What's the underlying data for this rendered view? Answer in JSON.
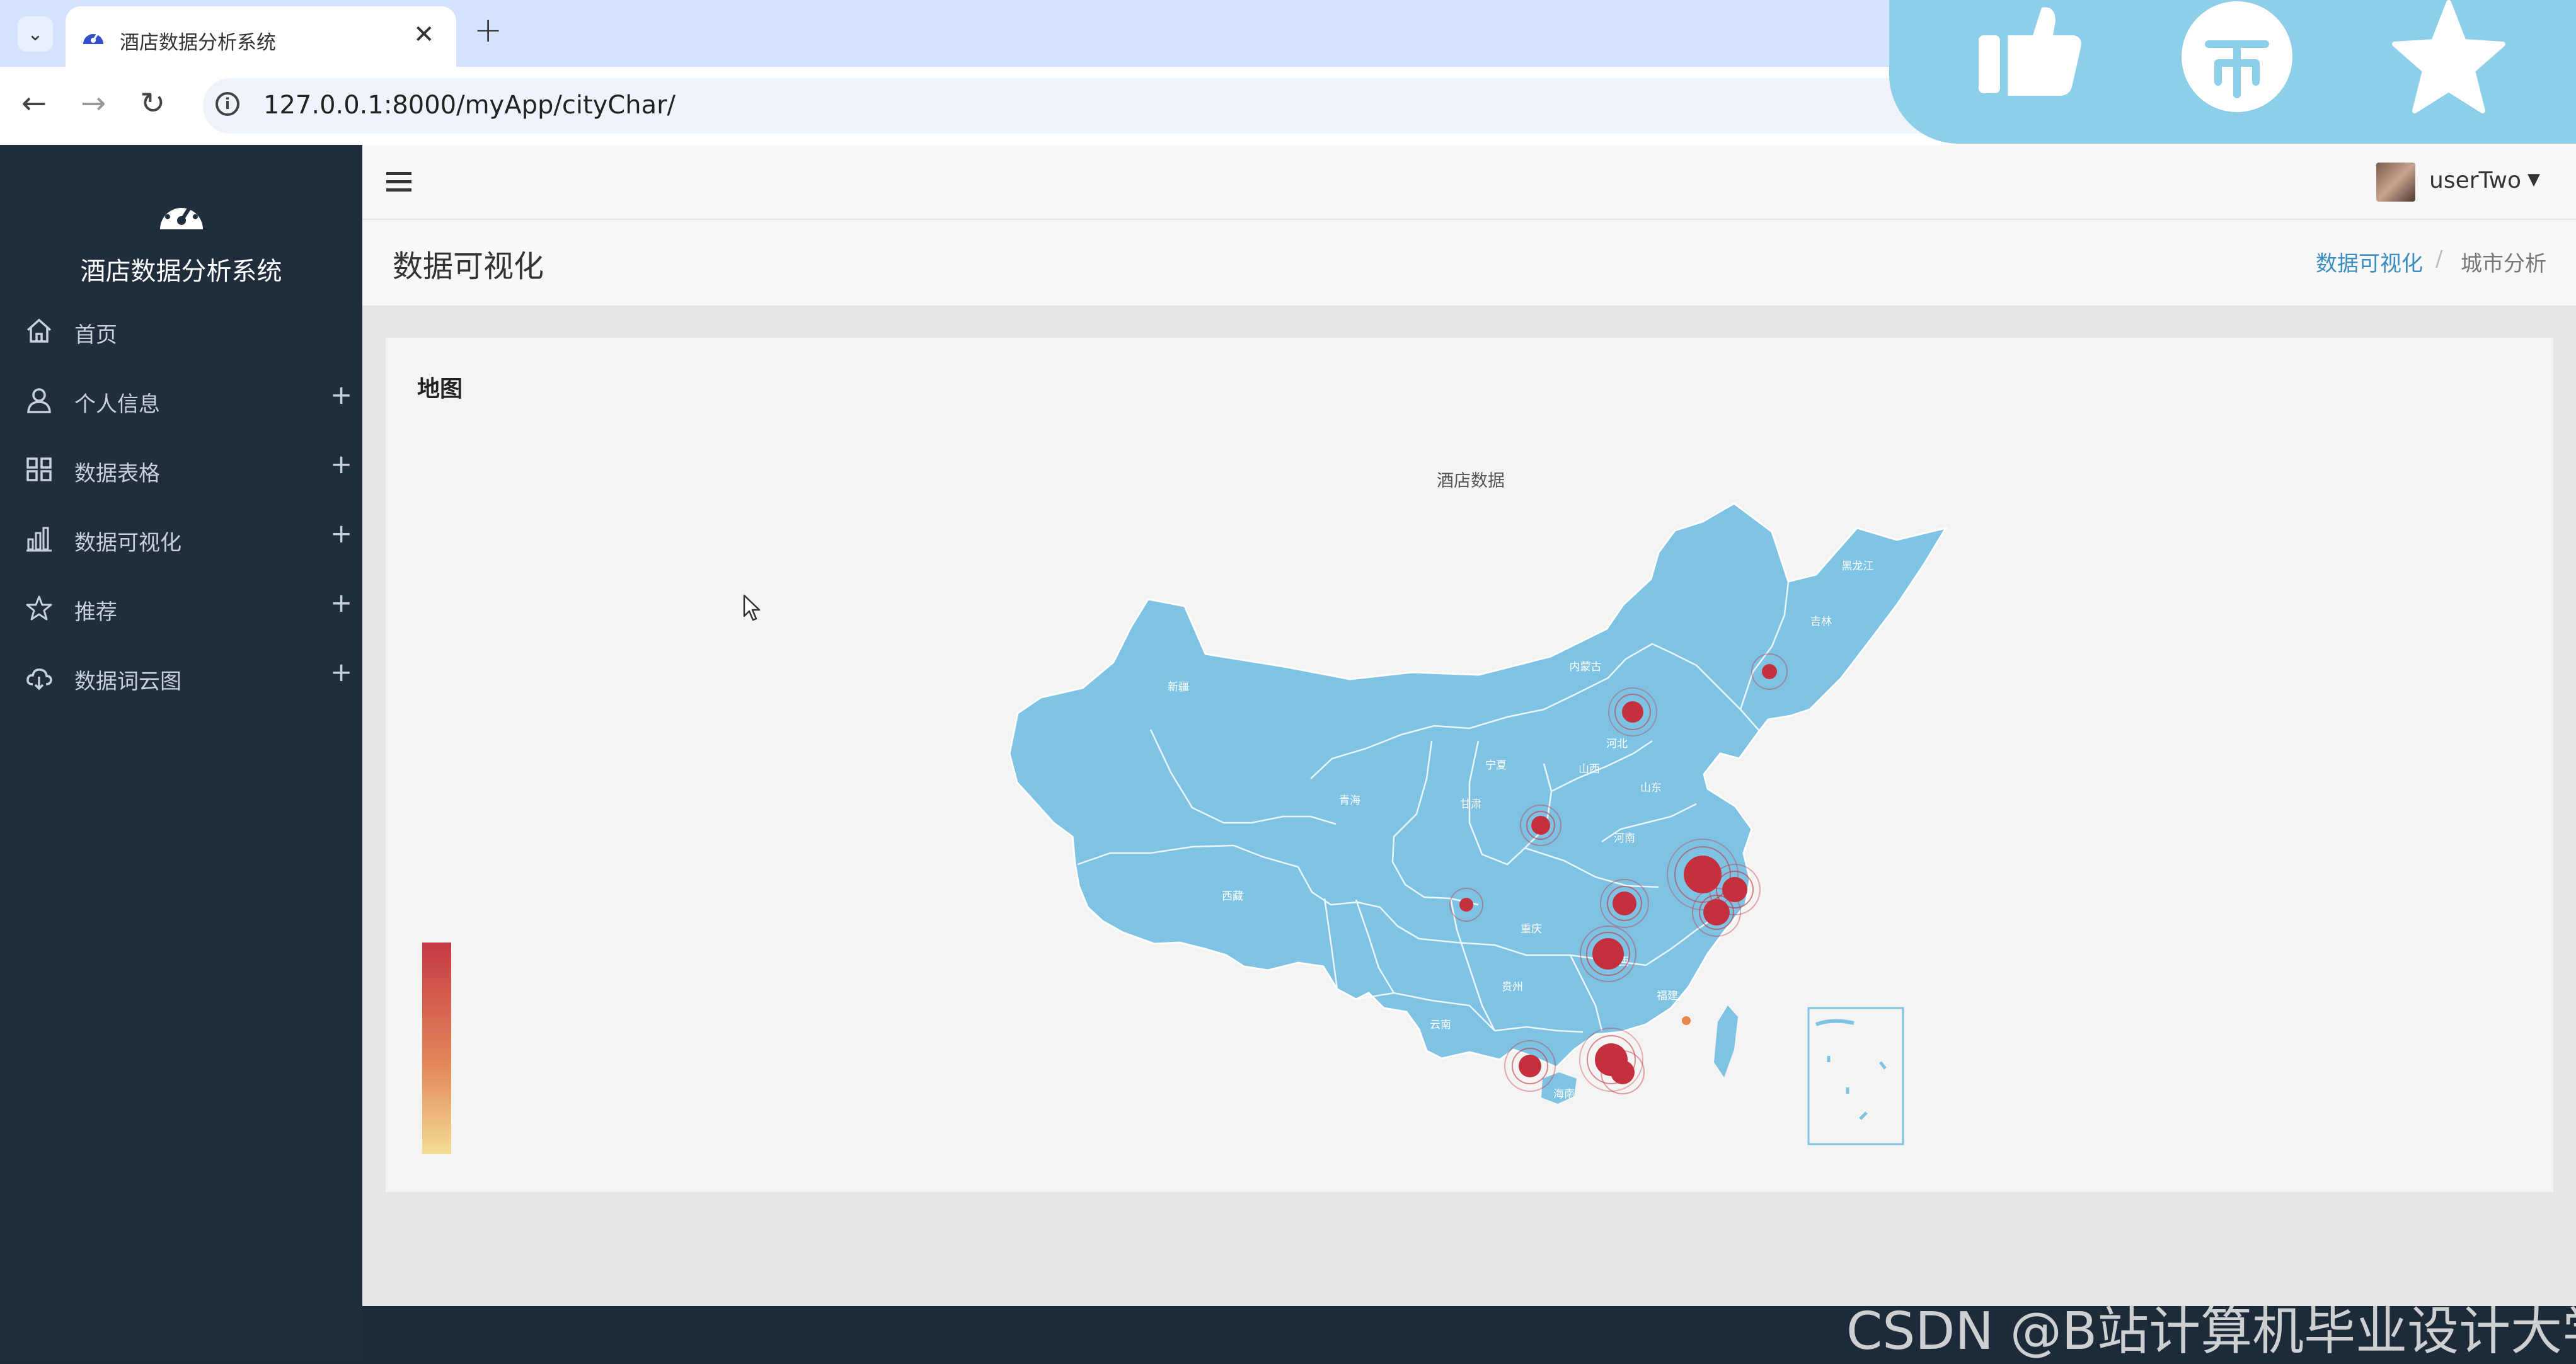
{
  "browser": {
    "tab_title": "酒店数据分析系统",
    "tab_close": "✕",
    "new_tab": "+",
    "url": "127.0.0.1:8000/myApp/cityChar/"
  },
  "sidebar": {
    "brand": "酒店数据分析系统",
    "items": [
      {
        "label": "首页",
        "icon": "home-icon",
        "expandable": false
      },
      {
        "label": "个人信息",
        "icon": "user-icon",
        "expandable": true
      },
      {
        "label": "数据表格",
        "icon": "grid-icon",
        "expandable": true
      },
      {
        "label": "数据可视化",
        "icon": "bar-chart-icon",
        "expandable": true
      },
      {
        "label": "推荐",
        "icon": "star-icon",
        "expandable": true
      },
      {
        "label": "数据词云图",
        "icon": "cloud-icon",
        "expandable": true
      }
    ],
    "plus": "+"
  },
  "header": {
    "username": "userTwo",
    "caret": "▼"
  },
  "page": {
    "title": "数据可视化",
    "breadcrumb": [
      "数据可视化",
      "城市分析"
    ],
    "breadcrumb_sep": "/"
  },
  "card": {
    "title": "地图",
    "map_title": "酒店数据"
  },
  "colors": {
    "sidebar_bg": "#1f2d3d",
    "map_fill": "#7ec3e3",
    "marker": "#c5303f",
    "link": "#3b8dbd"
  },
  "watermark": "CSDN @B站计算机毕业设计大学"
}
